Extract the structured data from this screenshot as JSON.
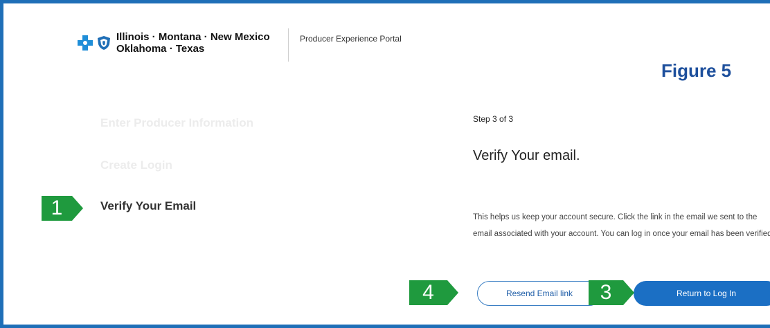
{
  "header": {
    "states_line1": "Illinois · Montana · New Mexico",
    "states_line2": "Oklahoma · Texas",
    "portal_name": "Producer Experience Portal"
  },
  "figure_label": "Figure 5",
  "steps": [
    {
      "label": "Enter Producer Information",
      "state": "completed"
    },
    {
      "label": "Create Login",
      "state": "completed"
    },
    {
      "label": "Verify Your Email",
      "state": "active"
    }
  ],
  "badges": {
    "b1": "1",
    "b4": "4",
    "b3": "3"
  },
  "main": {
    "step_count": "Step 3 of 3",
    "heading": "Verify Your email.",
    "body": "This helps us keep your account secure. Click the link in the email we sent to the email associated with your account. You can log in once your email has been verified.",
    "resend_label": "Resend Email link",
    "return_label": "Return to Log In"
  },
  "colors": {
    "frame": "#1f6fb7",
    "badge": "#1f9a3e",
    "primary_button": "#1b6fc4",
    "figure_label": "#1d4f9c"
  },
  "icons": [
    "blue-cross-icon",
    "blue-shield-icon"
  ]
}
